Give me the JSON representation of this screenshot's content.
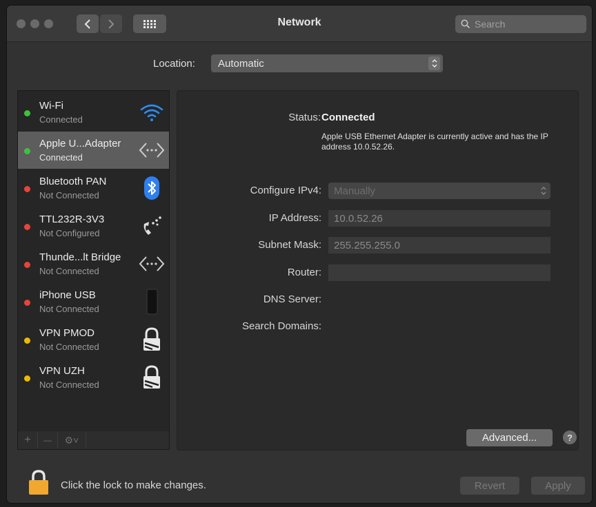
{
  "window": {
    "title": "Network",
    "search_placeholder": "Search",
    "grid_button": "⋮⋮⋮"
  },
  "location": {
    "label": "Location:",
    "value": "Automatic"
  },
  "services": [
    {
      "name": "Wi-Fi",
      "status": "Connected",
      "dot": "#3ec23e",
      "icon": "wifi-icon"
    },
    {
      "name": "Apple U...Adapter",
      "status": "Connected",
      "dot": "#3ec23e",
      "icon": "ethernet-icon",
      "selected": true
    },
    {
      "name": "Bluetooth PAN",
      "status": "Not Connected",
      "dot": "#e8443a",
      "icon": "bluetooth-icon"
    },
    {
      "name": "TTL232R-3V3",
      "status": "Not Configured",
      "dot": "#e8443a",
      "icon": "modem-phone-icon"
    },
    {
      "name": "Thunde...lt Bridge",
      "status": "Not Connected",
      "dot": "#e8443a",
      "icon": "thunderbolt-bridge-icon"
    },
    {
      "name": "iPhone USB",
      "status": "Not Connected",
      "dot": "#e8443a",
      "icon": "iphone-icon"
    },
    {
      "name": "VPN PMOD",
      "status": "Not Connected",
      "dot": "#f0b800",
      "icon": "vpn-lock-icon"
    },
    {
      "name": "VPN UZH",
      "status": "Not Connected",
      "dot": "#f0b800",
      "icon": "vpn-lock-icon"
    }
  ],
  "sidebar_toolbar": {
    "add": "+",
    "remove": "—",
    "gear": "⚙˅"
  },
  "detail": {
    "status_label": "Status:",
    "status_value": "Connected",
    "status_description": "Apple USB Ethernet Adapter is currently active and has the IP address 10.0.52.26.",
    "configure_label": "Configure IPv4:",
    "configure_value": "Manually",
    "ip_label": "IP Address:",
    "ip_value": "10.0.52.26",
    "subnet_label": "Subnet Mask:",
    "subnet_value": "255.255.255.0",
    "router_label": "Router:",
    "router_value": "",
    "dns_label": "DNS Server:",
    "search_domains_label": "Search Domains:",
    "advanced_button": "Advanced...",
    "help_button": "?"
  },
  "footer": {
    "lock_text": "Click the lock to make changes.",
    "revert_button": "Revert",
    "apply_button": "Apply"
  }
}
